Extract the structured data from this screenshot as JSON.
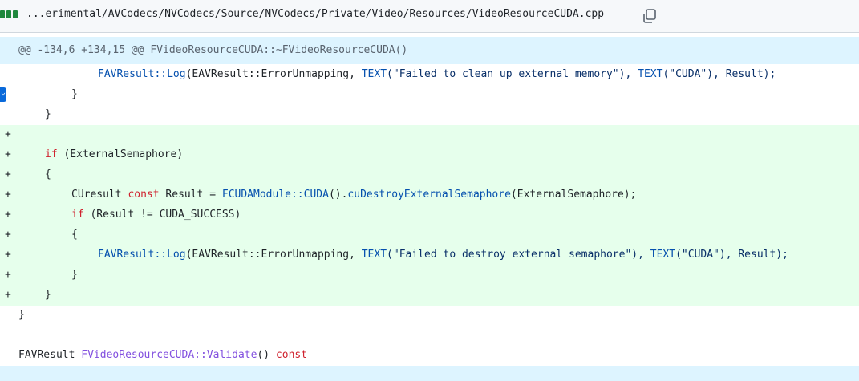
{
  "file": {
    "path": "...erimental/AVCodecs/NVCodecs/Source/NVCodecs/Private/Video/Resources/VideoResourceCUDA.cpp",
    "copy_icon": "copy-icon",
    "diff_color": "#1f883d"
  },
  "hunk": {
    "text": "@@ -134,6 +134,15 @@ FVideoResourceCUDA::~FVideoResourceCUDA()"
  },
  "lines": [
    {
      "kind": "context",
      "marker": "",
      "t": [
        "FAVResult::Log",
        "(EAVResult::ErrorUnmapping, ",
        "TEXT",
        "(\"Failed to clean up external memory\"), ",
        "TEXT",
        "(\"CUDA\"), Result);"
      ]
    },
    {
      "kind": "context",
      "marker": "",
      "text": "}"
    },
    {
      "kind": "context",
      "marker": "",
      "text": "}"
    },
    {
      "kind": "added",
      "marker": "+",
      "text": ""
    },
    {
      "kind": "added",
      "marker": "+",
      "t": [
        "if",
        " (ExternalSemaphore)"
      ]
    },
    {
      "kind": "added",
      "marker": "+",
      "text": "{"
    },
    {
      "kind": "added",
      "marker": "+",
      "t": [
        "CUresult ",
        "const",
        " Result = ",
        "FCUDAModule::CUDA",
        "().",
        "cuDestroyExternalSemaphore",
        "(ExternalSemaphore);"
      ]
    },
    {
      "kind": "added",
      "marker": "+",
      "t": [
        "if",
        " (Result != CUDA_SUCCESS)"
      ]
    },
    {
      "kind": "added",
      "marker": "+",
      "text": "{"
    },
    {
      "kind": "added",
      "marker": "+",
      "t": [
        "FAVResult::Log",
        "(EAVResult::ErrorUnmapping, ",
        "TEXT",
        "(\"Failed to destroy external semaphore\"), ",
        "TEXT",
        "(\"CUDA\"), Result);"
      ]
    },
    {
      "kind": "added",
      "marker": "+",
      "text": "}"
    },
    {
      "kind": "added",
      "marker": "+",
      "text": "}"
    },
    {
      "kind": "context",
      "marker": "",
      "text": "}"
    },
    {
      "kind": "context",
      "marker": "",
      "text": ""
    },
    {
      "kind": "context",
      "marker": "",
      "t": [
        "FAVResult ",
        "FVideoResourceCUDA::Validate",
        "() ",
        "const"
      ]
    }
  ],
  "colors": {
    "added_bg": "#e6ffec",
    "hunk_bg": "#ddf4ff",
    "keyword": "#cf222e",
    "function": "#8250df",
    "type": "#0550ae"
  }
}
